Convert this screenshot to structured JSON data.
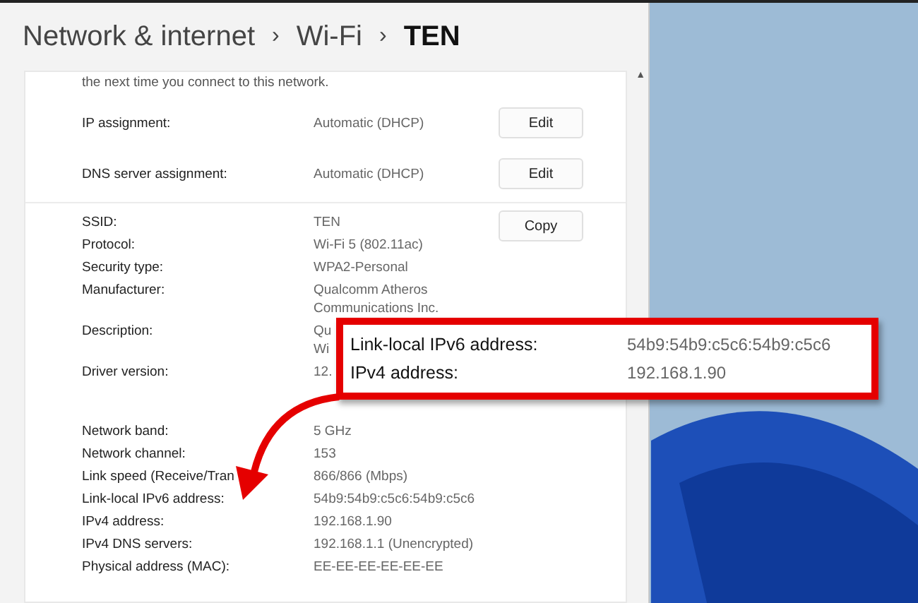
{
  "breadcrumb_separator": "›",
  "scroll_up": "▲",
  "breadcrumb": [
    {
      "text": "Network & internet",
      "current": false
    },
    {
      "text": "Wi-Fi",
      "current": false
    },
    {
      "text": "TEN",
      "current": true
    }
  ],
  "note": "the next time you connect to this network.",
  "settings": [
    {
      "label": "IP assignment:",
      "value": "Automatic (DHCP)",
      "button": "Edit"
    },
    {
      "label": "DNS server assignment:",
      "value": "Automatic (DHCP)",
      "button": "Edit"
    }
  ],
  "copy_button": "Copy",
  "groups": [
    [
      {
        "label": "SSID:",
        "value": [
          "TEN"
        ]
      },
      {
        "label": "Protocol:",
        "value": [
          "Wi-Fi 5 (802.11ac)"
        ]
      },
      {
        "label": "Security type:",
        "value": [
          "WPA2-Personal"
        ]
      },
      {
        "label": "Manufacturer:",
        "value": [
          "Qualcomm Atheros",
          "Communications Inc."
        ]
      },
      {
        "label": "Description:",
        "value": [
          "Qu",
          "Wi"
        ]
      },
      {
        "label": "Driver version:",
        "value": [
          "12."
        ]
      }
    ],
    [
      {
        "label": "Network band:",
        "value": [
          "5 GHz"
        ]
      },
      {
        "label": "Network channel:",
        "value": [
          "153"
        ]
      },
      {
        "label": "Link speed (Receive/Tran",
        "value": [
          "866/866 (Mbps)"
        ]
      },
      {
        "label": "Link-local IPv6 address:",
        "value": [
          "54b9:54b9:c5c6:54b9:c5c6"
        ]
      },
      {
        "label": "IPv4 address:",
        "value": [
          "192.168.1.90"
        ]
      },
      {
        "label": "IPv4 DNS servers:",
        "value": [
          "192.168.1.1 (Unencrypted)"
        ]
      },
      {
        "label": "Physical address (MAC):",
        "value": [
          "EE-EE-EE-EE-EE-EE"
        ]
      }
    ]
  ],
  "callout": [
    {
      "label": "Link-local IPv6 address:",
      "value": "54b9:54b9:c5c6:54b9:c5c6"
    },
    {
      "label": "IPv4 address:",
      "value": "192.168.1.90"
    }
  ]
}
